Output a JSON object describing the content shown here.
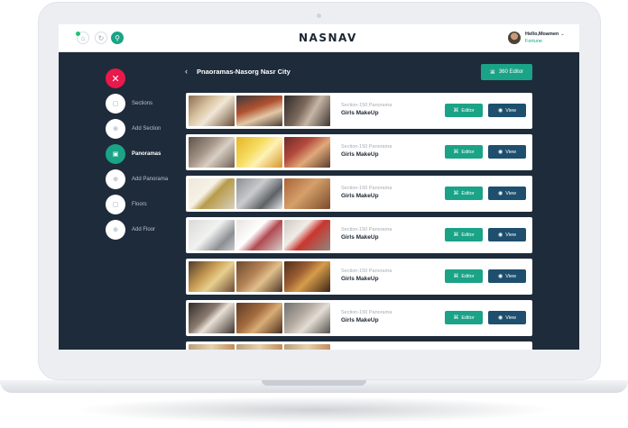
{
  "topbar": {
    "logo": "NASNAV",
    "greeting": "Hello,Moamen",
    "account_sub": "Fortune",
    "chevron": "⌄"
  },
  "sidebar": {
    "close_glyph": "✕",
    "items": [
      {
        "label": "Sections",
        "icon": "section-icon",
        "glyph": "▢"
      },
      {
        "label": "Add Section",
        "icon": "add-section-icon",
        "glyph": "⊕"
      },
      {
        "label": "Panoramas",
        "icon": "panorama-icon",
        "glyph": "▣"
      },
      {
        "label": "Add Panorama",
        "icon": "add-panorama-icon",
        "glyph": "⊕"
      },
      {
        "label": "Floors",
        "icon": "floor-icon",
        "glyph": "▢"
      },
      {
        "label": "Add Floor",
        "icon": "add-floor-icon",
        "glyph": "⊕"
      }
    ],
    "active_item": "Panoramas"
  },
  "header": {
    "back_glyph": "‹",
    "title": "Pnaoramas-Nasorg Nasr City",
    "editor360_label": "360 Editor"
  },
  "buttons": {
    "editor_label": "Editor",
    "view_label": "View",
    "editor_glyph": "⌘",
    "view_glyph": "◉"
  },
  "panoramas": [
    {
      "section": "Section-150 Panorama",
      "name": "Girls MakeUp"
    },
    {
      "section": "Section-150 Panorama",
      "name": "Girls MakeUp"
    },
    {
      "section": "Section-150 Panorama",
      "name": "Girls MakeUp"
    },
    {
      "section": "Section-150 Panorama",
      "name": "Girls MakeUp"
    },
    {
      "section": "Section-150 Panorama",
      "name": "Girls MakeUp"
    },
    {
      "section": "Section-150 Panorama",
      "name": "Girls MakeUp"
    }
  ],
  "colors": {
    "accent": "#1aa386",
    "view_button": "#1e4f6e",
    "close_button": "#e8194b",
    "screen_background": "#1e2b3a"
  }
}
